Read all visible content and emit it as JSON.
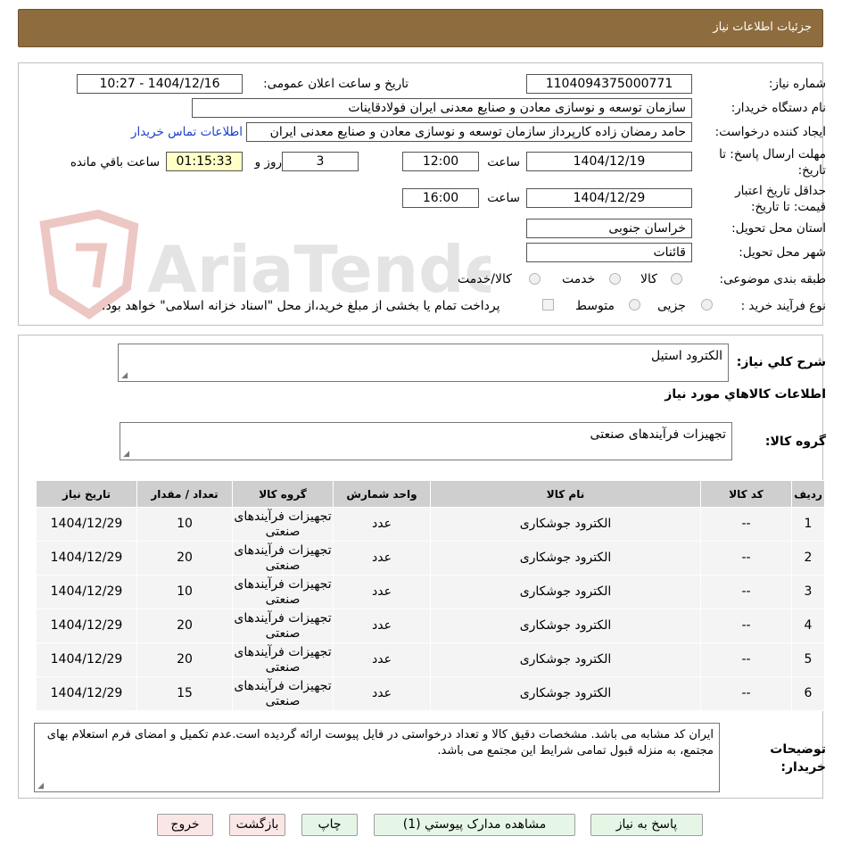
{
  "header": {
    "title": "جزئیات اطلاعات نیاز"
  },
  "watermark": {
    "text": "AriaTender.neT"
  },
  "fields": {
    "need_number_label": "شماره نیاز:",
    "need_number": "1104094375000771",
    "announce_label": "تاریخ و ساعت اعلان عمومی:",
    "announce_value": "1404/12/16 - 10:27",
    "buyer_org_label": "نام دستگاه خریدار:",
    "buyer_org": "سازمان توسعه و نوسازی معادن و صنایع معدنی ایران فولادقاینات",
    "creator_label": "ایجاد کننده درخواست:",
    "creator": "حامد  رمضان زاده  کارپرداز  سازمان توسعه و نوسازی معادن و صنایع معدنی ایران",
    "contact_link": "اطلاعات تماس خریدار",
    "deadline_label": "مهلت ارسال پاسخ: تا تاریخ:",
    "deadline_date": "1404/12/19",
    "time_label": "ساعت",
    "deadline_time": "12:00",
    "days_remaining": "3",
    "days_label": "روز و",
    "time_remaining": "01:15:33",
    "remaining_label": "ساعت باقي مانده",
    "validity_label": "حداقل تاریخ اعتبار قیمت: تا تاریخ:",
    "validity_date": "1404/12/29",
    "validity_time_label": "ساعت",
    "validity_time": "16:00",
    "province_label": "استان محل تحویل:",
    "province": "خراسان جنوبی",
    "city_label": "شهر محل تحویل:",
    "city": "قائنات",
    "category_label": "طبقه بندی موضوعی:",
    "category_options": [
      "کالا",
      "خدمت",
      "کالا/خدمت"
    ],
    "process_label": "نوع فرآیند خرید :",
    "process_options": [
      "جزیی",
      "متوسط"
    ],
    "payment_note": "پرداخت تمام یا بخشی از مبلغ خرید،از محل \"اسناد خزانه اسلامی\" خواهد بود."
  },
  "summary": {
    "label": "شرح کلي نياز:",
    "value": "الکترود استیل"
  },
  "goods_section": {
    "title": "اطلاعات کالاهاي مورد نياز",
    "group_label": "گروه کالا:",
    "group_value": "تجهیزات فرآیندهای صنعتی"
  },
  "table": {
    "headers": [
      "رديف",
      "کد کالا",
      "نام کالا",
      "واحد شمارش",
      "گروه کالا",
      "تعداد / مقدار",
      "تاریخ نیاز"
    ],
    "rows": [
      [
        "1",
        "--",
        "الکترود جوشکاری",
        "عدد",
        "تجهیزات فرآیندهای صنعتی",
        "10",
        "1404/12/29"
      ],
      [
        "2",
        "--",
        "الکترود جوشکاری",
        "عدد",
        "تجهیزات فرآیندهای صنعتی",
        "20",
        "1404/12/29"
      ],
      [
        "3",
        "--",
        "الکترود جوشکاری",
        "عدد",
        "تجهیزات فرآیندهای صنعتی",
        "10",
        "1404/12/29"
      ],
      [
        "4",
        "--",
        "الکترود جوشکاری",
        "عدد",
        "تجهیزات فرآیندهای صنعتی",
        "20",
        "1404/12/29"
      ],
      [
        "5",
        "--",
        "الکترود جوشکاری",
        "عدد",
        "تجهیزات فرآیندهای صنعتی",
        "20",
        "1404/12/29"
      ],
      [
        "6",
        "--",
        "الکترود جوشکاری",
        "عدد",
        "تجهیزات فرآیندهای صنعتی",
        "15",
        "1404/12/29"
      ]
    ]
  },
  "notes": {
    "label": "توضیحات خریدار:",
    "value": "ایران کد مشابه می باشد. مشخصات دقیق کالا و تعداد درخواستی در فایل پیوست ارائه گردیده است.عدم تکمیل و امضای فرم استعلام بهای مجتمع، به منزله قبول تمامی شرایط این مجتمع می باشد."
  },
  "buttons": {
    "reply": "پاسخ به نیاز",
    "attachments": "مشاهده مدارک پیوستي (1)",
    "print": "چاپ",
    "back": "بازگشت",
    "exit": "خروج"
  },
  "colors": {
    "header_bg": "#8e6c3d",
    "link": "#1a3fcf",
    "time_box": "#ffffc6"
  }
}
